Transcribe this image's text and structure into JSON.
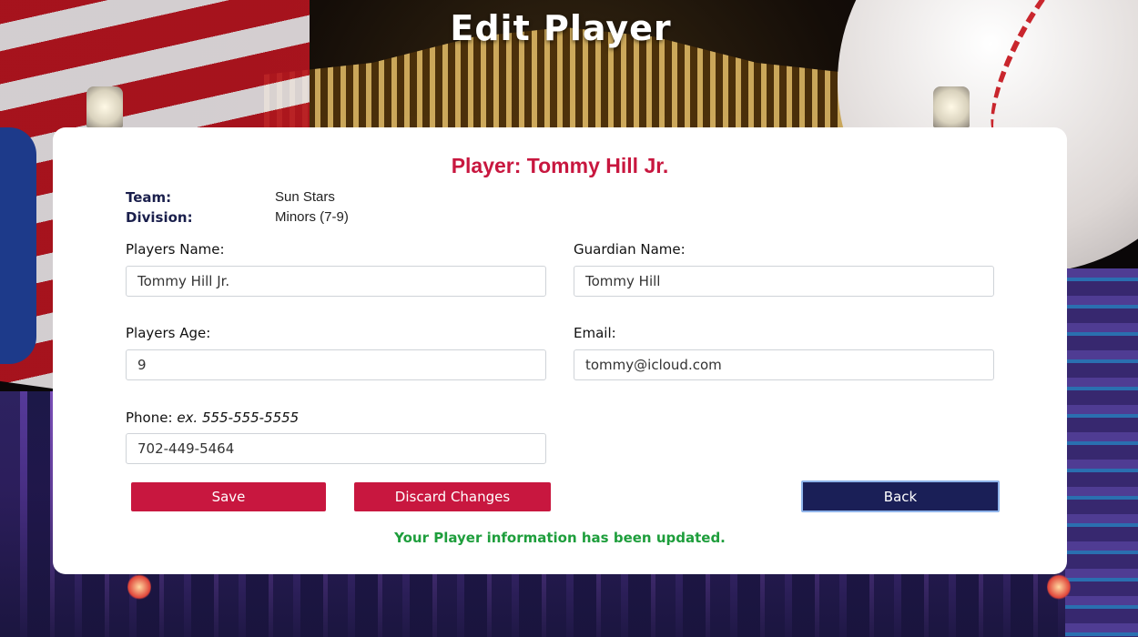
{
  "page": {
    "title": "Edit Player"
  },
  "player": {
    "heading": "Player: Tommy Hill Jr.",
    "team_label": "Team:",
    "team_value": "Sun Stars",
    "division_label": "Division:",
    "division_value": "Minors (7-9)"
  },
  "form": {
    "players_name": {
      "label": "Players Name:",
      "value": "Tommy Hill Jr."
    },
    "guardian_name": {
      "label": "Guardian Name:",
      "value": "Tommy Hill"
    },
    "players_age": {
      "label": "Players Age:",
      "value": "9"
    },
    "email": {
      "label": "Email:",
      "value": "tommy@icloud.com"
    },
    "phone": {
      "label": "Phone:",
      "hint": "ex. 555-555-5555",
      "value": "702-449-5464"
    }
  },
  "buttons": {
    "save": "Save",
    "discard": "Discard Changes",
    "back": "Back"
  },
  "status": {
    "message": "Your Player information has been updated."
  },
  "colors": {
    "accent_red": "#c8173f",
    "navy": "#1a1f57",
    "success_green": "#1e9e3c"
  }
}
